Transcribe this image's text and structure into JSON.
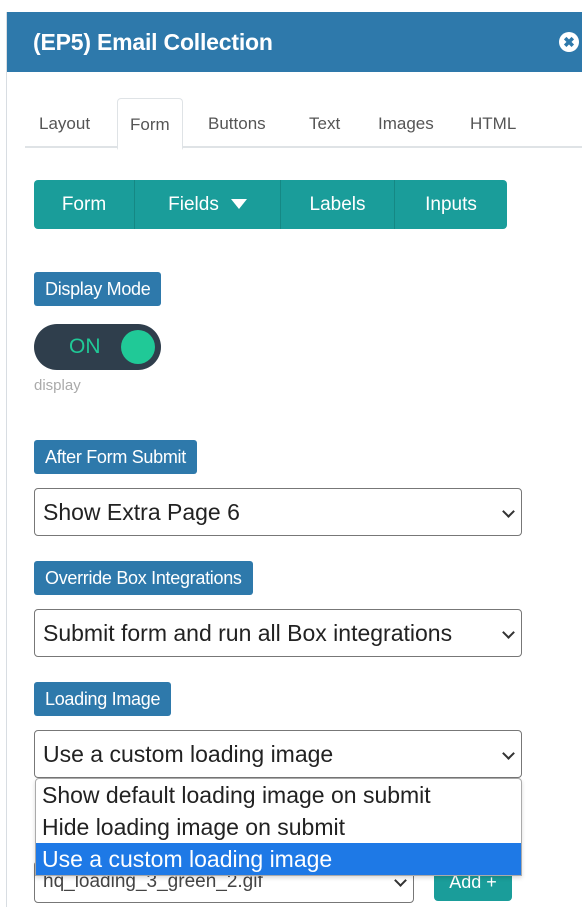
{
  "panel": {
    "title": "(EP5) Email Collection",
    "close_glyph": "✖"
  },
  "tabs": [
    {
      "label": "Layout",
      "active": false
    },
    {
      "label": "Form",
      "active": true
    },
    {
      "label": "Buttons",
      "active": false
    },
    {
      "label": "Text",
      "active": false
    },
    {
      "label": "Images",
      "active": false
    },
    {
      "label": "HTML",
      "active": false
    }
  ],
  "subnav": {
    "form": "Form",
    "fields": "Fields",
    "labels": "Labels",
    "inputs": "Inputs"
  },
  "display_mode": {
    "label": "Display Mode",
    "toggle_text": "ON",
    "sublabel": "display"
  },
  "after_submit": {
    "label": "After Form Submit",
    "value": "Show Extra Page 6"
  },
  "override": {
    "label": "Override Box Integrations",
    "value": "Submit form and run all Box integrations"
  },
  "loading": {
    "label": "Loading Image",
    "value": "Use a custom loading image",
    "options": [
      "Show default loading image on submit",
      "Hide loading image on submit",
      "Use a custom loading image"
    ],
    "selected_index": 2
  },
  "image_picker": {
    "value": "hq_loading_3_green_2.gif",
    "add_label": "Add +"
  },
  "colors": {
    "titlebar": "#2e79ab",
    "teal": "#1a9d9a",
    "toggle_on": "#20c997",
    "option_highlight": "#1e79e6"
  }
}
